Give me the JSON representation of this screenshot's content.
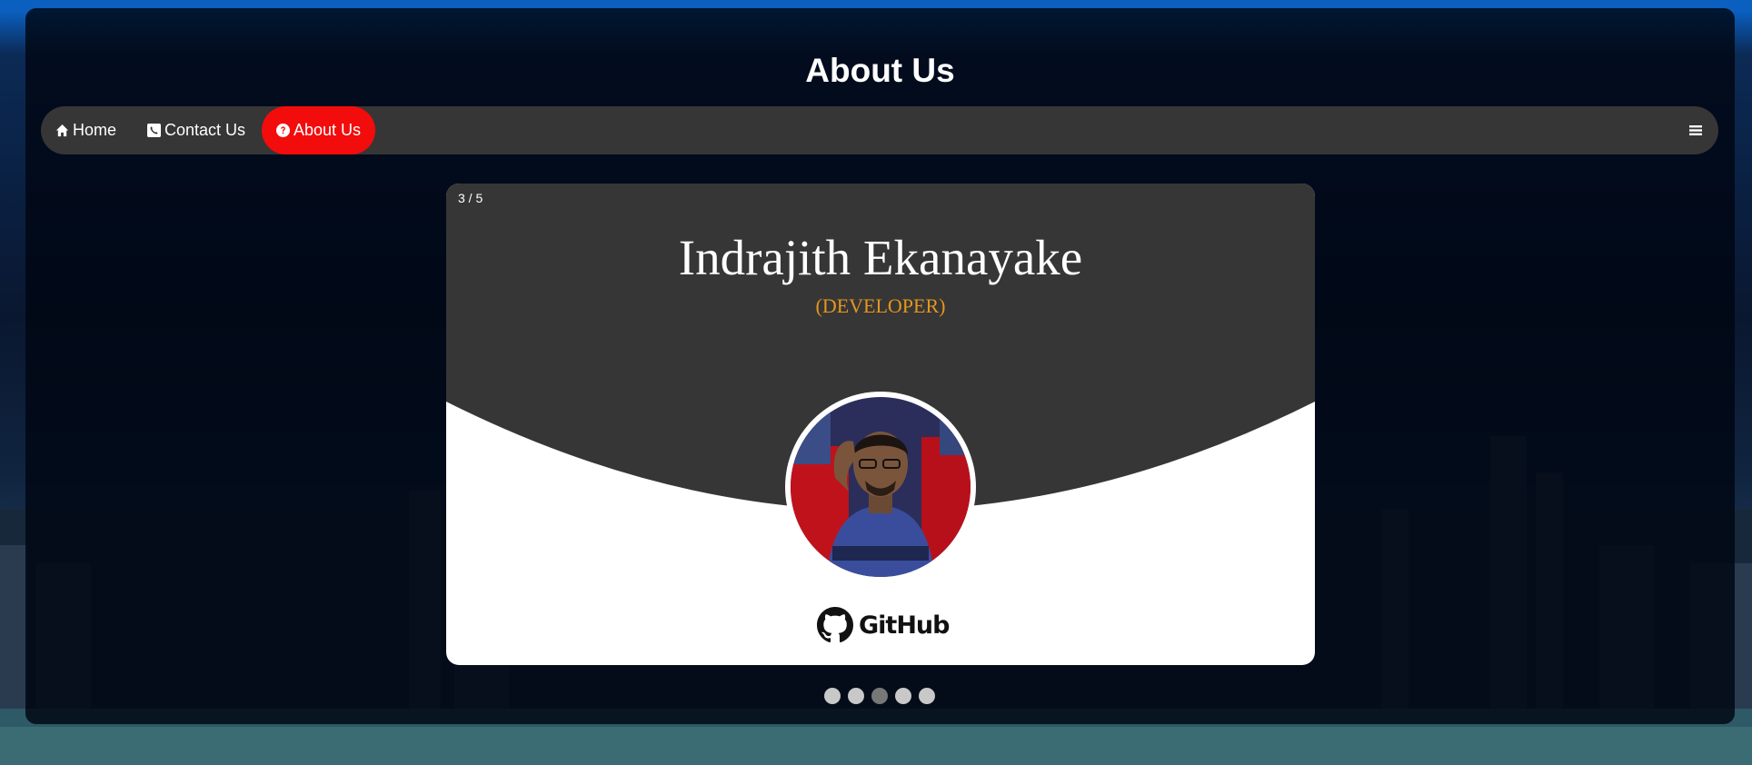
{
  "page": {
    "title": "About Us"
  },
  "nav": {
    "items": [
      {
        "label": "Home",
        "icon": "home-icon"
      },
      {
        "label": "Contact Us",
        "icon": "phone-icon"
      },
      {
        "label": "About Us",
        "icon": "question-circle-icon",
        "active": true
      }
    ],
    "menu_icon": "hamburger-menu-icon",
    "active_color": "#f30c0c"
  },
  "slider": {
    "counter": "3 / 5",
    "current": 3,
    "total": 5,
    "member": {
      "name": "Indrajith Ekanayake",
      "role": "(DEVELOPER)",
      "link_label": "GitHub"
    }
  },
  "colors": {
    "card_dark": "#363636",
    "role_text": "#e5961d",
    "navbar_bg": "#363636"
  }
}
